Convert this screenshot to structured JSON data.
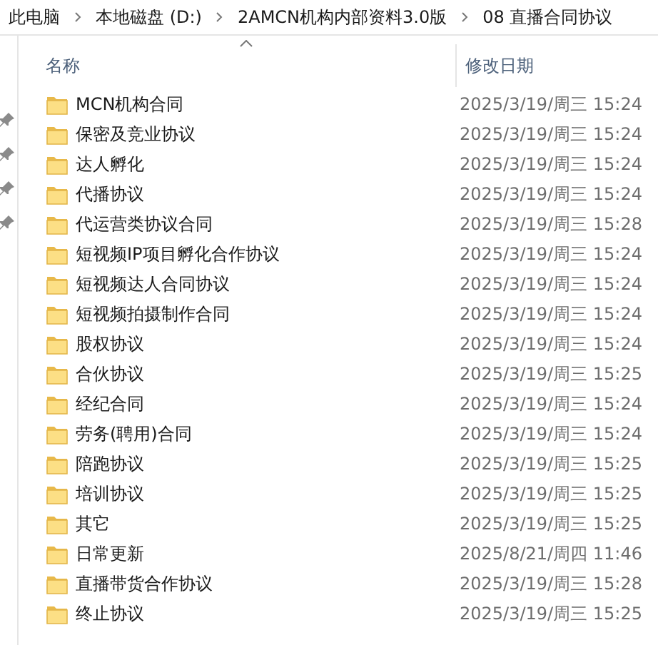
{
  "breadcrumb": [
    "此电脑",
    "本地磁盘 (D:)",
    "2AMCN机构内部资料3.0版",
    "08 直播合同协议"
  ],
  "nav_pane": {
    "items": [
      {
        "pinned": true
      },
      {
        "pinned": true
      },
      {
        "pinned": true
      },
      {
        "pinned": true
      }
    ]
  },
  "columns": [
    {
      "label": "名称",
      "sorted": true
    },
    {
      "label": "修改日期",
      "sorted": false
    }
  ],
  "rows": [
    {
      "name": "MCN机构合同",
      "modified": "2025/3/19/周三 15:24"
    },
    {
      "name": "保密及竞业协议",
      "modified": "2025/3/19/周三 15:24"
    },
    {
      "name": "达人孵化",
      "modified": "2025/3/19/周三 15:24"
    },
    {
      "name": "代播协议",
      "modified": "2025/3/19/周三 15:24"
    },
    {
      "name": "代运营类协议合同",
      "modified": "2025/3/19/周三 15:28"
    },
    {
      "name": "短视频IP项目孵化合作协议",
      "modified": "2025/3/19/周三 15:24"
    },
    {
      "name": "短视频达人合同协议",
      "modified": "2025/3/19/周三 15:24"
    },
    {
      "name": "短视频拍摄制作合同",
      "modified": "2025/3/19/周三 15:24"
    },
    {
      "name": "股权协议",
      "modified": "2025/3/19/周三 15:24"
    },
    {
      "name": "合伙协议",
      "modified": "2025/3/19/周三 15:25"
    },
    {
      "name": "经纪合同",
      "modified": "2025/3/19/周三 15:24"
    },
    {
      "name": "劳务(聘用)合同",
      "modified": "2025/3/19/周三 15:24"
    },
    {
      "name": "陪跑协议",
      "modified": "2025/3/19/周三 15:25"
    },
    {
      "name": "培训协议",
      "modified": "2025/3/19/周三 15:25"
    },
    {
      "name": "其它",
      "modified": "2025/3/19/周三 15:25"
    },
    {
      "name": "日常更新",
      "modified": "2025/8/21/周四 11:46"
    },
    {
      "name": "直播带货合作协议",
      "modified": "2025/3/19/周三 15:28"
    },
    {
      "name": "终止协议",
      "modified": "2025/3/19/周三 15:25"
    }
  ]
}
